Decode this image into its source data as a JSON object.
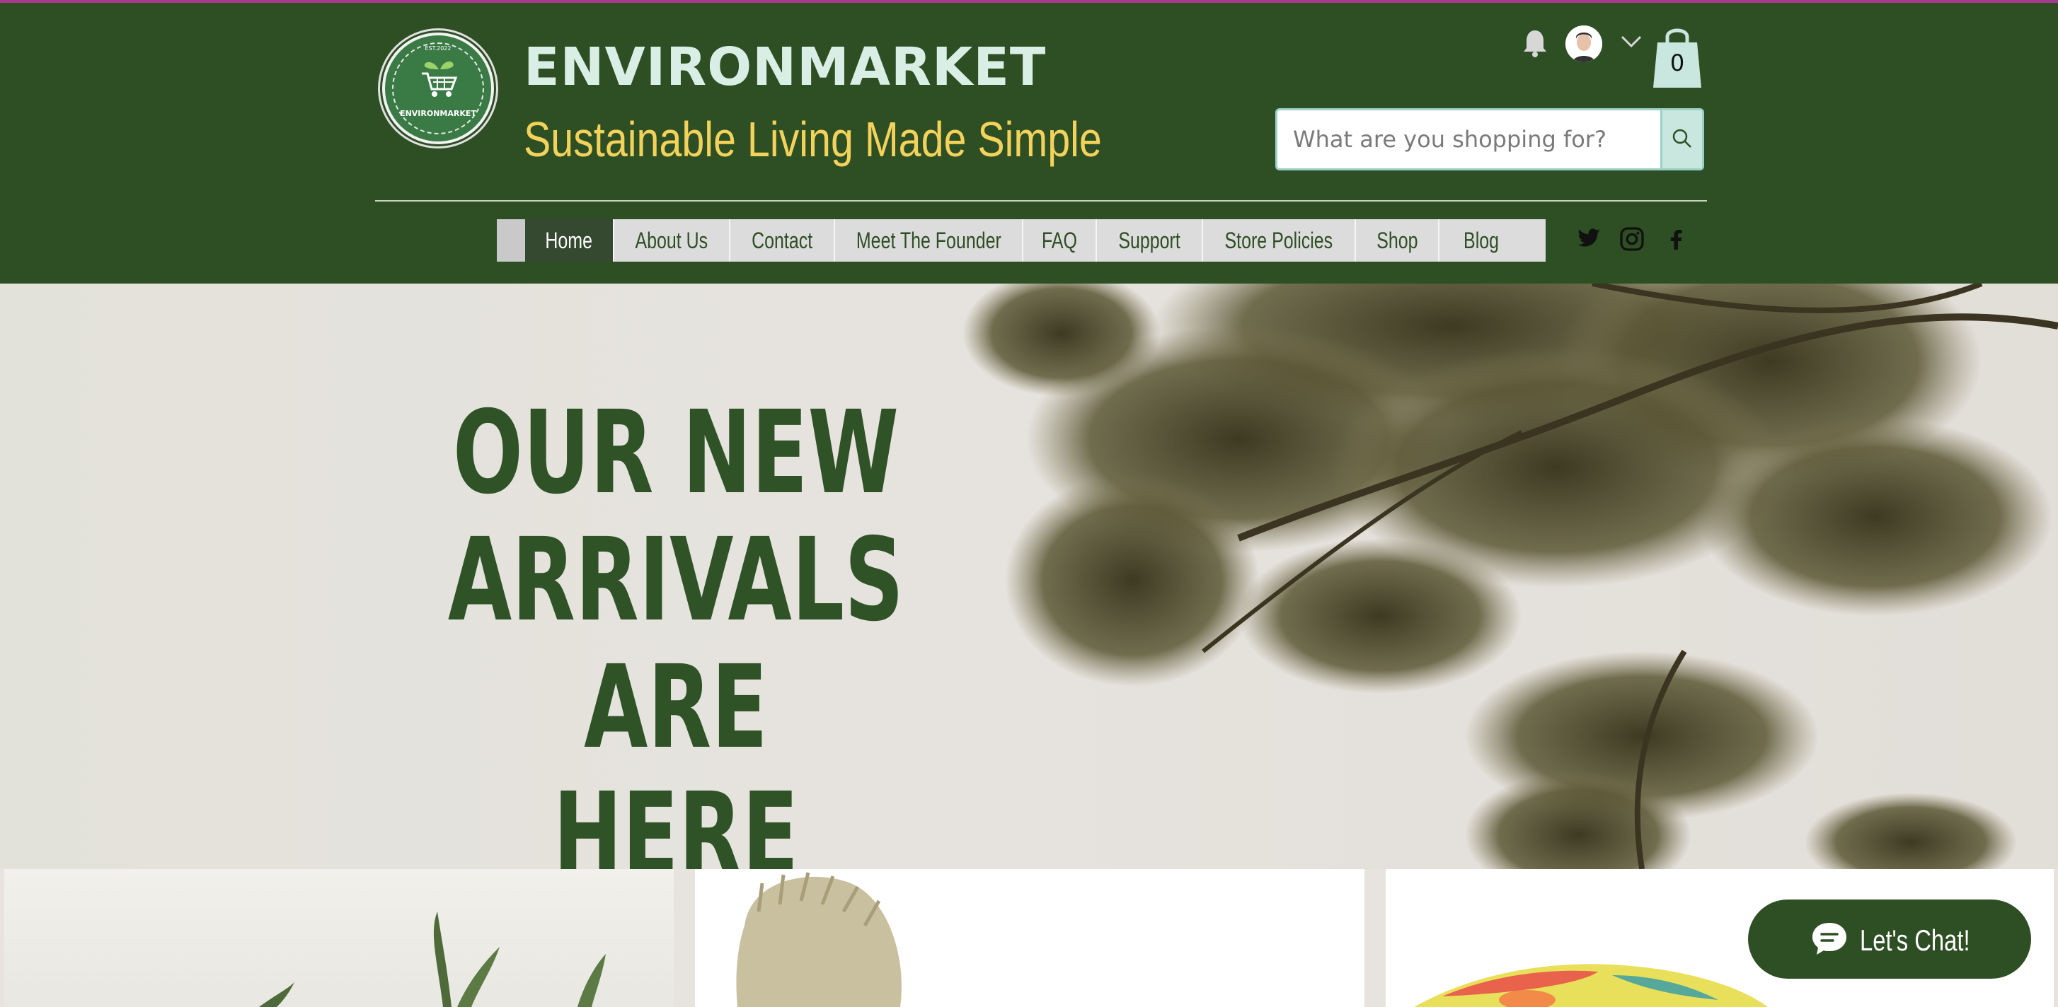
{
  "brand": {
    "logo_est": "EST.2022",
    "logo_name": "ENVIRONMARKET",
    "title": "ENVIRONMARKET",
    "tagline": "Sustainable Living Made Simple"
  },
  "header": {
    "cart_count": "0",
    "search_placeholder": "What are you shopping for?",
    "icons": [
      "bell-icon",
      "avatar",
      "chevron-down-icon",
      "shopping-bag-icon",
      "search-icon"
    ]
  },
  "nav": {
    "items": [
      {
        "label": "Home",
        "active": true
      },
      {
        "label": "About Us"
      },
      {
        "label": "Contact"
      },
      {
        "label": "Meet The Founder"
      },
      {
        "label": "FAQ"
      },
      {
        "label": "Support"
      },
      {
        "label": "Store Policies"
      },
      {
        "label": "Shop"
      },
      {
        "label": "Blog"
      }
    ]
  },
  "social": [
    "twitter-icon",
    "instagram-icon",
    "facebook-icon"
  ],
  "hero": {
    "line1": "OUR NEW",
    "line2": "ARRIVALS ARE",
    "line3": "HERE"
  },
  "chat": {
    "label": "Let's Chat!"
  },
  "colors": {
    "header_bg": "#2e4e24",
    "title": "#d9efe6",
    "tagline": "#f3d25c",
    "hero_text": "#2f5227",
    "nav_bg": "#dcdcdc",
    "nav_active": "#34492f"
  }
}
